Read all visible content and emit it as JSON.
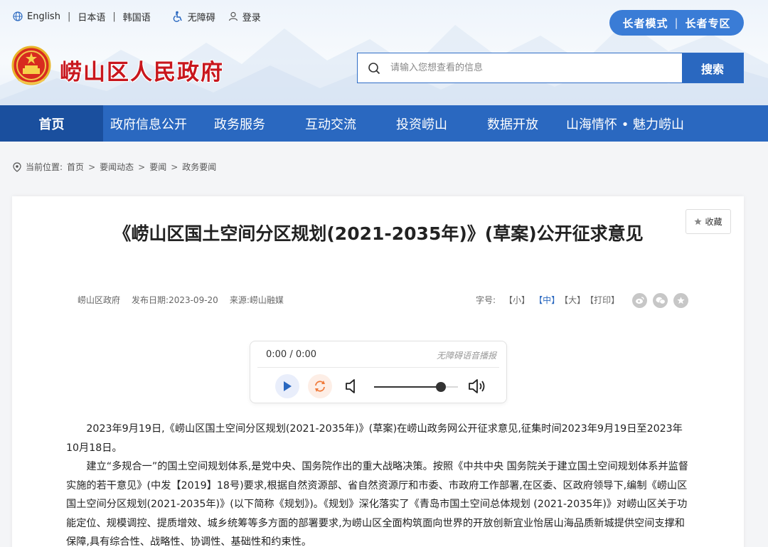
{
  "topbar": {
    "english": "English",
    "japanese": "日本语",
    "korean": "韩国语",
    "accessible": "无障碍",
    "login": "登录"
  },
  "elder": {
    "mode": "长者模式",
    "zone": "长者专区"
  },
  "site": {
    "title": "崂山区人民政府"
  },
  "search": {
    "placeholder": "请输入您想查看的信息",
    "button": "搜索"
  },
  "nav": {
    "items": [
      {
        "label": "首页",
        "active": true
      },
      {
        "label": "政府信息公开"
      },
      {
        "label": "政务服务"
      },
      {
        "label": "互动交流"
      },
      {
        "label": "投资崂山"
      },
      {
        "label": "数据开放"
      },
      {
        "label": "山海情怀 • 魅力崂山"
      }
    ]
  },
  "breadcrumb": {
    "prefix": "当前位置:",
    "items": [
      "首页",
      "要闻动态",
      "要闻",
      "政务要闻"
    ]
  },
  "article": {
    "favorite": "收藏",
    "title": "《崂山区国土空间分区规划(2021-2035年)》(草案)公开征求意见",
    "publisher": "崂山区政府",
    "date_label": "发布日期:",
    "date": "2023-09-20",
    "source_label": "来源:",
    "source": "崂山融媒",
    "fontsize_label": "字号:",
    "fs_small": "【小】",
    "fs_medium": "【中】",
    "fs_large": "【大】",
    "print": "【打印】",
    "paragraphs": [
      "2023年9月19日,《崂山区国土空间分区规划(2021-2035年)》(草案)在崂山政务网公开征求意见,征集时间2023年9月19日至2023年10月18日。",
      "建立“多规合一”的国土空间规划体系,是党中央、国务院作出的重大战略决策。按照《中共中央 国务院关于建立国土空间规划体系并监督实施的若干意见》(中发【2019】18号)要求,根据自然资源部、省自然资源厅和市委、市政府工作部署,在区委、区政府领导下,编制《崂山区国土空间分区规划(2021-2035年)》(以下简称《规划》)。《规划》深化落实了《青岛市国土空间总体规划 (2021-2035年)》对崂山区关于功能定位、规模调控、提质增效、城乡统筹等多方面的部署要求,为崂山区全面构筑面向世界的开放创新宜业怡居山海品质新城提供空间支撑和保障,具有综合性、战略性、协调性、基础性和约束性。"
    ]
  },
  "player": {
    "time": "0:00 / 0:00",
    "title": "无障碍语音播报",
    "volume": 0.8
  },
  "icons": [
    "globe-icon",
    "accessibility-icon",
    "user-icon",
    "search-icon",
    "location-pin-icon",
    "star-icon",
    "play-icon",
    "loop-icon",
    "mute-icon",
    "volume-up-icon"
  ],
  "colors": {
    "primary": "#2a68c0",
    "nav_active": "#1a4f9e",
    "title_red": "#c8161d",
    "elder_btn": "#3a7cd6"
  }
}
